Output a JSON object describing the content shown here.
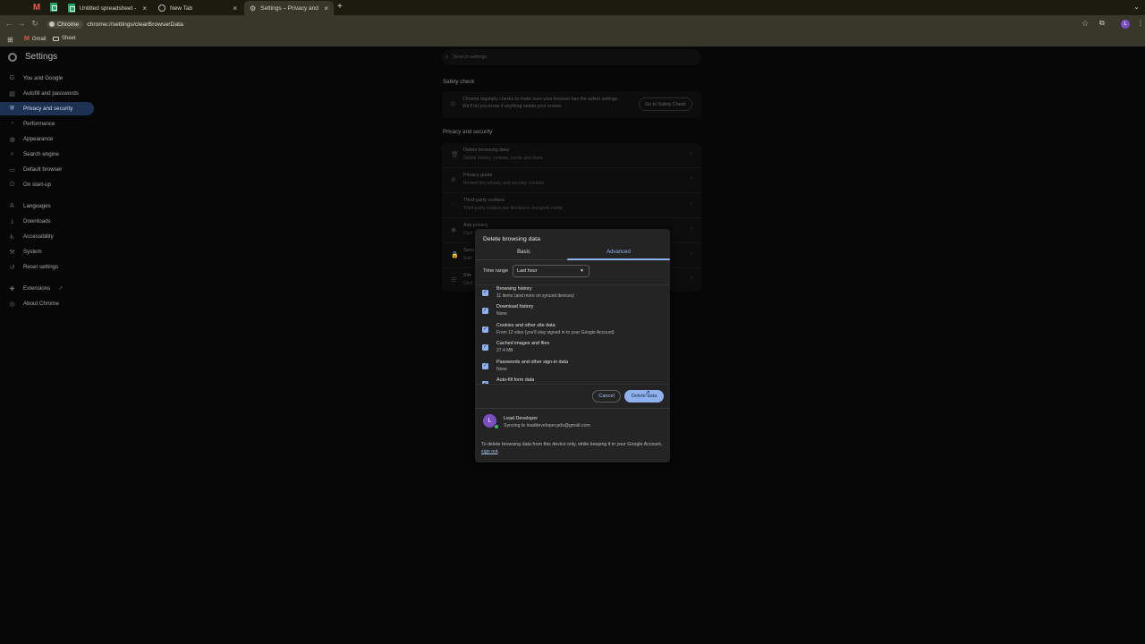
{
  "browser": {
    "tabs": [
      {
        "label": "",
        "icon": "gmail-icon"
      },
      {
        "label": "",
        "icon": "sheets-icon"
      },
      {
        "label": "Untitled spreadsheet - Google",
        "icon": "sheets-icon"
      },
      {
        "label": "New Tab",
        "icon": "newtab-icon"
      },
      {
        "label": "Settings – Privacy and securi",
        "icon": "gear-icon",
        "active": true
      }
    ],
    "close_glyph": "×",
    "new_tab_glyph": "+",
    "chip_label": "Chrome",
    "url": "chrome://settings/clearBrowserData",
    "profile_initial": "L",
    "bookmarks": [
      {
        "label": "Gmail"
      },
      {
        "label": "Sheet"
      }
    ]
  },
  "settings": {
    "title": "Settings",
    "search_placeholder": "Search settings",
    "sidebar": [
      {
        "label": "You and Google",
        "icon": "google-icon"
      },
      {
        "label": "Autofill and passwords",
        "icon": "clipboard-icon"
      },
      {
        "label": "Privacy and security",
        "icon": "shield-icon",
        "active": true
      },
      {
        "label": "Performance",
        "icon": "speedometer-icon"
      },
      {
        "label": "Appearance",
        "icon": "palette-icon"
      },
      {
        "label": "Search engine",
        "icon": "search-icon"
      },
      {
        "label": "Default browser",
        "icon": "browser-icon"
      },
      {
        "label": "On start-up",
        "icon": "power-icon"
      },
      {
        "label": "Languages",
        "icon": "translate-icon"
      },
      {
        "label": "Downloads",
        "icon": "download-icon"
      },
      {
        "label": "Accessibility",
        "icon": "accessibility-icon"
      },
      {
        "label": "System",
        "icon": "wrench-icon"
      },
      {
        "label": "Reset settings",
        "icon": "reset-icon"
      },
      {
        "label": "Extensions",
        "icon": "puzzle-icon"
      },
      {
        "label": "About Chrome",
        "icon": "chrome-icon"
      }
    ],
    "safety_check": {
      "heading": "Safety check",
      "text": "Chrome regularly checks to make sure your browser has the safest settings. We'll let you know if anything needs your review.",
      "button": "Go to Safety Check"
    },
    "privacy": {
      "heading": "Privacy and security",
      "rows": [
        {
          "title": "Delete browsing data",
          "sub": "Delete history, cookies, cache and more",
          "icon": "trash-icon"
        },
        {
          "title": "Privacy guide",
          "sub": "Review key privacy and security controls",
          "icon": "privacy-guide-icon"
        },
        {
          "title": "Third-party cookies",
          "sub": "Third-party cookies are blocked in Incognito mode",
          "icon": "cookie-icon"
        },
        {
          "title": "Ads privacy",
          "sub": "Cust",
          "icon": "ads-icon"
        },
        {
          "title": "Secu",
          "sub": "Safe",
          "icon": "lock-icon"
        },
        {
          "title": "Site",
          "sub": "Cont",
          "icon": "sliders-icon"
        }
      ]
    }
  },
  "dialog": {
    "title": "Delete browsing data",
    "tabs": [
      {
        "label": "Basic"
      },
      {
        "label": "Advanced",
        "active": true
      }
    ],
    "time_range_label": "Time range",
    "time_range_value": "Last hour",
    "items": [
      {
        "title": "Browsing history",
        "sub": "11 items (and more on synced devices)",
        "checked": true
      },
      {
        "title": "Download history",
        "sub": "None",
        "checked": true
      },
      {
        "title": "Cookies and other site data",
        "sub": "From 12 sites (you'll stay signed in to your Google Account)",
        "checked": true
      },
      {
        "title": "Cached images and files",
        "sub": "27.4 MB",
        "checked": true
      },
      {
        "title": "Passwords and other sign-in data",
        "sub": "None",
        "checked": true
      },
      {
        "title": "Auto-fill form data",
        "sub": "",
        "checked": true
      }
    ],
    "check_glyph": "✓",
    "cancel": "Cancel",
    "delete": "Delete data",
    "account": {
      "initial": "L",
      "name": "Lead Developer",
      "sync": "Syncing to leaddeveloper.pds@gmail.com"
    },
    "footnote_text": "To delete browsing data from this device only, while keeping it in your Google Account, ",
    "footnote_link": "sign out",
    "footnote_end": "."
  },
  "colors": {
    "accent": "#8fb2ee",
    "dialog_bg": "#242424",
    "sidebar_active": "#1d3152",
    "avatar": "#7b4fc4"
  }
}
